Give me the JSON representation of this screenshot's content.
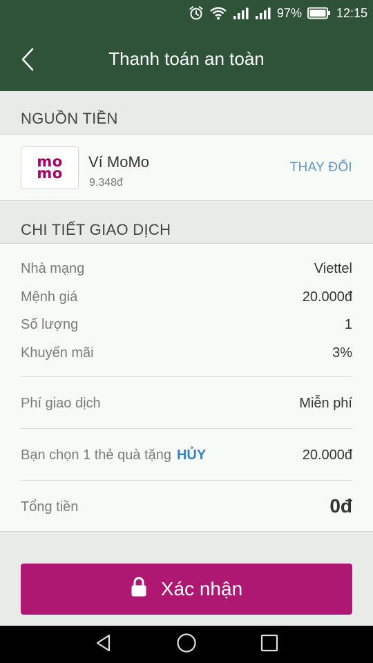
{
  "status_bar": {
    "battery": "97%",
    "time": "12:15"
  },
  "header": {
    "title": "Thanh toán an toàn"
  },
  "source": {
    "section_title": "NGUỒN TIỀN",
    "wallet_logo_line1": "mo",
    "wallet_logo_line2": "mo",
    "wallet_name": "Ví MoMo",
    "wallet_balance": "9.348đ",
    "change_label": "THAY ĐỔI"
  },
  "details": {
    "section_title": "CHI TIẾT GIAO DỊCH",
    "carrier_label": "Nhà mạng",
    "carrier_value": "Viettel",
    "denomination_label": "Mệnh giá",
    "denomination_value": "20.000đ",
    "quantity_label": "Số lượng",
    "quantity_value": "1",
    "promotion_label": "Khuyến mãi",
    "promotion_value": "3%",
    "fee_label": "Phí giao dịch",
    "fee_value": "Miễn phí",
    "gift_label": "Bạn chọn 1 thẻ quà tặng",
    "gift_cancel": "HỦY",
    "gift_value": "20.000đ",
    "total_label": "Tổng tiền",
    "total_value": "0đ"
  },
  "confirm": {
    "label": "Xác nhận"
  },
  "colors": {
    "header_bg": "#2e5339",
    "brand": "#ae1873",
    "link": "#5f93c4"
  },
  "icons": {
    "back": "back-arrow-icon",
    "lock": "lock-icon",
    "alarm": "alarm-icon",
    "wifi": "wifi-icon",
    "signal": "signal-icon",
    "battery": "battery-icon",
    "nav_back": "nav-back-icon",
    "nav_home": "nav-home-icon",
    "nav_recent": "nav-recent-icon"
  }
}
